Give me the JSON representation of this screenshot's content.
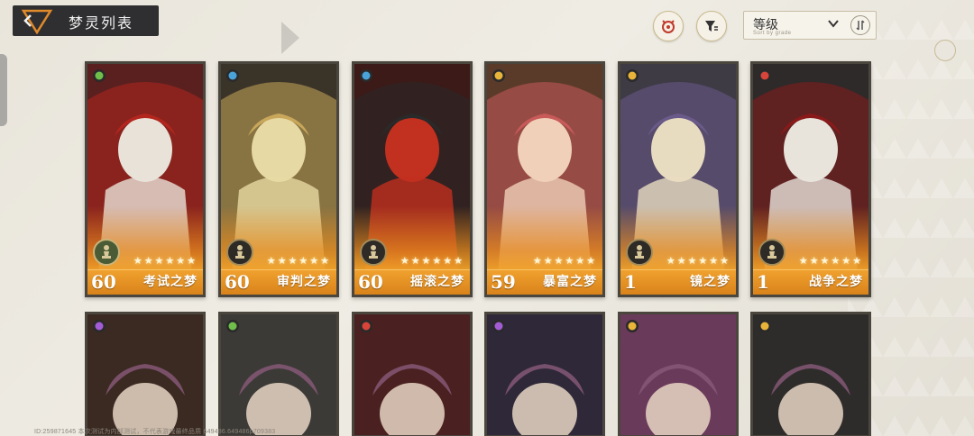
{
  "header": {
    "title": "梦灵列表",
    "sort_label": "等级",
    "sort_sub": "Sort by grade"
  },
  "colors": {
    "accent": "#e0901f",
    "header_bg": "#2f2f31",
    "card_border": "#4a453d"
  },
  "cards_row1": [
    {
      "level": "60",
      "name": "考试之梦",
      "stars": "★★★★★★",
      "element_icon": "plant-element-icon",
      "element_color": "#6fbf4a",
      "pawn": "green"
    },
    {
      "level": "60",
      "name": "审判之梦",
      "stars": "★★★★★★",
      "element_icon": "water-element-icon",
      "element_color": "#4aa3d8",
      "pawn": "dark"
    },
    {
      "level": "60",
      "name": "摇滚之梦",
      "stars": "★★★★★★",
      "element_icon": "water-element-icon",
      "element_color": "#4aa3d8",
      "pawn": "dark"
    },
    {
      "level": "59",
      "name": "暴富之梦",
      "stars": "★★★★★★",
      "element_icon": "star-element-icon",
      "element_color": "#e8b43a",
      "pawn": "none"
    },
    {
      "level": "1",
      "name": "镜之梦",
      "stars": "★★★★★★",
      "element_icon": "star-element-icon",
      "element_color": "#e8b43a",
      "pawn": "dark"
    },
    {
      "level": "1",
      "name": "战争之梦",
      "stars": "★★★★★★",
      "element_icon": "fire-element-icon",
      "element_color": "#d8443a",
      "pawn": "dark"
    }
  ],
  "cards_row2": [
    {
      "element_icon": "spirit-element-icon",
      "element_color": "#a45cd6"
    },
    {
      "element_icon": "plant-element-icon",
      "element_color": "#6fbf4a"
    },
    {
      "element_icon": "fire-element-icon",
      "element_color": "#d8443a"
    },
    {
      "element_icon": "spirit-element-icon",
      "element_color": "#a45cd6"
    },
    {
      "element_icon": "star-element-icon",
      "element_color": "#e8b43a"
    },
    {
      "element_icon": "sun-element-icon",
      "element_color": "#e8b43a"
    }
  ],
  "footer": {
    "text": "ID:259871645 本次测试为内部测试，不代表游戏最终品质 649486.649486p709383"
  }
}
